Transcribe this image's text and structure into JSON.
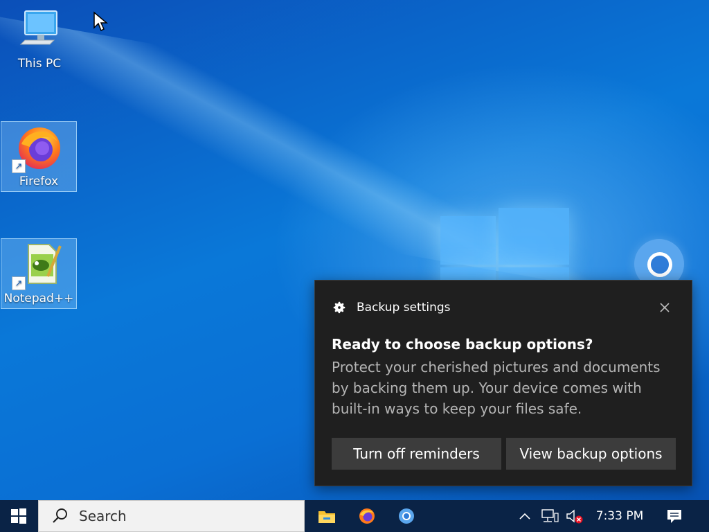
{
  "desktop": {
    "icons": [
      {
        "label": "This PC",
        "icon": "computer-icon"
      },
      {
        "label": "Firefox",
        "icon": "firefox-icon"
      },
      {
        "label": "Notepad++",
        "icon": "notepad-plus-plus-icon"
      }
    ],
    "partial_icon": "chrome-icon"
  },
  "toast": {
    "app_name": "Backup settings",
    "app_icon": "gear-icon",
    "title": "Ready to choose backup options?",
    "body": "Protect your cherished pictures and documents by backing them up. Your device comes with built-in ways to keep your files safe.",
    "buttons": {
      "turn_off": "Turn off reminders",
      "view": "View backup options"
    },
    "close_icon": "close-icon"
  },
  "taskbar": {
    "search_placeholder": "Search",
    "pinned": [
      "file-explorer-icon",
      "firefox-icon",
      "chrome-icon"
    ],
    "tray": {
      "icons": [
        "chevron-up-icon",
        "network-icon",
        "volume-muted-icon"
      ],
      "time": "7:33 PM",
      "notification_icon": "action-center-icon"
    }
  },
  "colors": {
    "taskbar": "#0a2346",
    "toast_bg": "#1f1f1f",
    "toast_button": "#3c3c3c",
    "desktop_blue": "#0a78d8"
  }
}
